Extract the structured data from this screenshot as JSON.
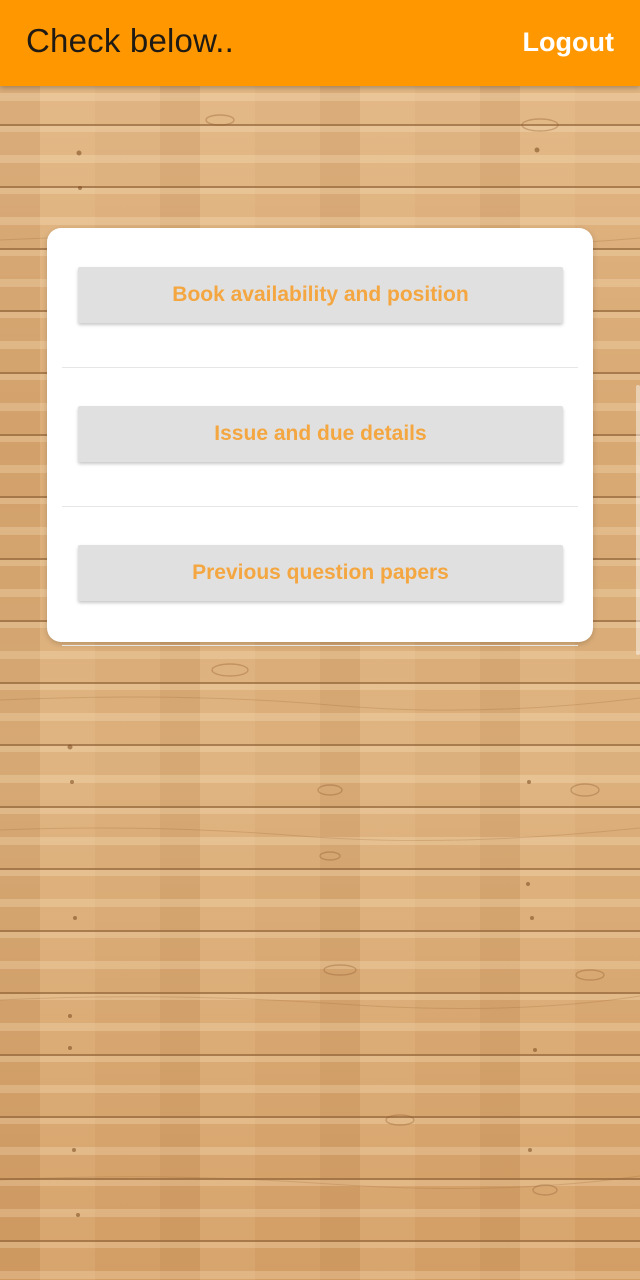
{
  "app_bar": {
    "title": "Check below..",
    "logout_label": "Logout",
    "color": "#ff9800"
  },
  "menu": {
    "items": [
      {
        "label": "Book availability and position"
      },
      {
        "label": "Issue and due details"
      },
      {
        "label": "Previous question papers"
      }
    ],
    "button_text_color": "#f4a640",
    "button_bg_color": "#e0e0e0"
  },
  "background": {
    "style": "wood-planks"
  }
}
